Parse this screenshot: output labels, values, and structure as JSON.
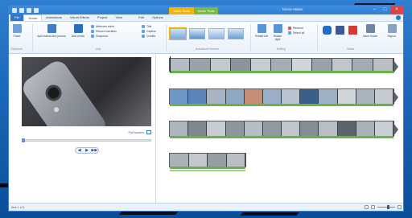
{
  "window": {
    "title": "Movie Maker",
    "context_tabs": [
      "Video Tools",
      "Music Tools"
    ]
  },
  "tabs": [
    "File",
    "Home",
    "Animations",
    "Visual Effects",
    "Project",
    "View",
    "Edit",
    "Options"
  ],
  "ribbon": {
    "paste_label": "Paste",
    "add_videos_label": "Add videos and photos",
    "add_music_label": "Add music",
    "webcam_label": "Webcam video",
    "narration_label": "Record narration",
    "snapshot_label": "Snapshot",
    "title_label": "Title",
    "caption_label": "Caption",
    "credits_label": "Credits",
    "rotate_left_label": "Rotate left",
    "rotate_right_label": "Rotate right",
    "remove_label": "Remove",
    "select_all_label": "Select all",
    "save_movie_label": "Save movie",
    "sign_in_label": "Sign in",
    "groups": [
      "Clipboard",
      "Add",
      "AutoMovie themes",
      "Editing",
      "Share"
    ]
  },
  "preview": {
    "fullscreen_label": "Full screen"
  },
  "status": {
    "text": "Item 1 of 1"
  },
  "colors": {
    "accent": "#2b78cc",
    "video_tools": "#f5b400",
    "music_tools": "#7ab943",
    "audio_track": "#6ab04c"
  }
}
